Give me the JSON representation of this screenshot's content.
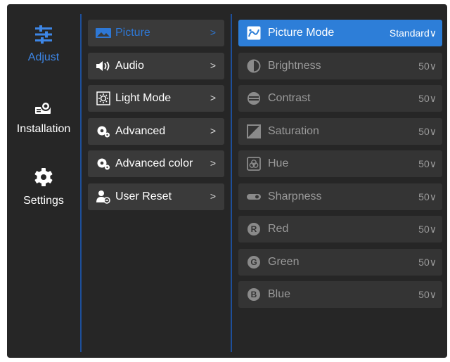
{
  "rail": {
    "items": [
      {
        "label": "Adjust",
        "icon": "sliders-icon",
        "active": true
      },
      {
        "label": "Installation",
        "icon": "projector-icon",
        "active": false
      },
      {
        "label": "Settings",
        "icon": "gear-icon",
        "active": false
      }
    ]
  },
  "menu": {
    "items": [
      {
        "label": "Picture",
        "icon": "picture-icon",
        "active": true
      },
      {
        "label": "Audio",
        "icon": "speaker-icon"
      },
      {
        "label": "Light Mode",
        "icon": "sun-icon"
      },
      {
        "label": "Advanced",
        "icon": "gears-icon"
      },
      {
        "label": "Advanced color",
        "icon": "gears-icon"
      },
      {
        "label": "User Reset",
        "icon": "user-reset-icon"
      }
    ],
    "chevron": ">"
  },
  "list": {
    "items": [
      {
        "label": "Picture Mode",
        "value": "Standard",
        "icon": "picture-mode-icon",
        "active": true
      },
      {
        "label": "Brightness",
        "value": "50",
        "icon": "half-circle-icon"
      },
      {
        "label": "Contrast",
        "value": "50",
        "icon": "contrast-icon"
      },
      {
        "label": "Saturation",
        "value": "50",
        "icon": "saturation-icon"
      },
      {
        "label": "Hue",
        "value": "50",
        "icon": "hue-icon"
      },
      {
        "label": "Sharpness",
        "value": "50",
        "icon": "sharpness-icon"
      },
      {
        "label": "Red",
        "value": "50",
        "icon": "r-circle-icon",
        "letter": "R"
      },
      {
        "label": "Green",
        "value": "50",
        "icon": "g-circle-icon",
        "letter": "G"
      },
      {
        "label": "Blue",
        "value": "50",
        "icon": "b-circle-icon",
        "letter": "B"
      }
    ],
    "dropdown_glyph": "∨"
  },
  "colors": {
    "accent": "#2d7ed8",
    "background": "#262626",
    "divider": "#1e4f9a"
  }
}
